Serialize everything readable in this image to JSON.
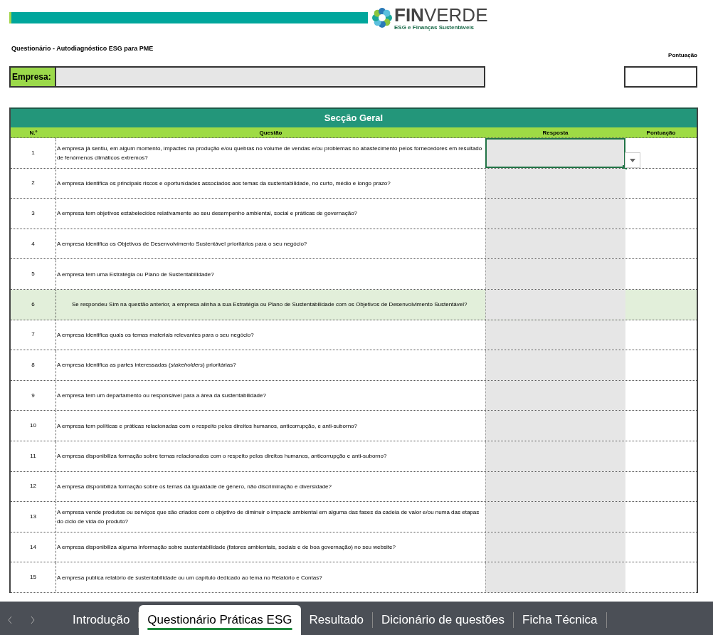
{
  "logo": {
    "name": "**FIN**VERDE",
    "tagline": "ESG e Finanças Sustentáveis"
  },
  "title": "Questionário - Autodiagnóstico ESG para PME",
  "score_label": "Pontuação",
  "company": {
    "label": "Empresa:"
  },
  "section": {
    "title": "Secção Geral",
    "columns": [
      "N.º",
      "Questão",
      "Resposta",
      "Pontuação"
    ],
    "rows": [
      {
        "number": "1",
        "question": "A empresa já sentiu, em algum momento, impactes na produção e/ou quebras no volume de vendas e/ou problemas no abastecimento pelos fornecedores em resultado de fenómenos climáticos extremos?",
        "kind": "main",
        "selected": true
      },
      {
        "number": "2",
        "question": "A empresa identifica os principais riscos e oportunidades associados aos temas da sustentabilidade, no curto, médio e longo prazo?",
        "kind": "main",
        "selected": false
      },
      {
        "number": "3",
        "question": "A empresa tem objetivos estabelecidos relativamente ao seu desempenho ambiental, social e práticas de governação?",
        "kind": "main",
        "selected": false
      },
      {
        "number": "4",
        "question": "A empresa identifica os Objetivos de Desenvolvimento Sustentável prioritários para o seu negócio?",
        "kind": "main",
        "selected": false
      },
      {
        "number": "5",
        "question": "A empresa tem uma Estratégia ou Plano de Sustentabilidade?",
        "kind": "main",
        "selected": false
      },
      {
        "number": "6",
        "question": "Se respondeu Sim na questão anterior, a empresa alinha a sua Estratégia ou Plano de Sustentabilidade com os Objetivos de Desenvolvimento Sustentável?",
        "kind": "conditional",
        "selected": false
      },
      {
        "number": "7",
        "question": "A empresa identifica quais os temas materiais relevantes para o seu negócio?",
        "kind": "main",
        "selected": false
      },
      {
        "number": "8",
        "question": "A empresa identifica as partes interessadas (*stakeholders*) prioritárias?",
        "kind": "main",
        "selected": false
      },
      {
        "number": "9",
        "question": "A empresa tem um departamento ou responsável para a área da sustentabilidade?",
        "kind": "main",
        "selected": false
      },
      {
        "number": "10",
        "question": "A empresa tem políticas e práticas relacionadas com o respeito pelos direitos humanos, anticorrupção, e anti-suborno?",
        "kind": "main",
        "selected": false
      },
      {
        "number": "11",
        "question": "A empresa disponibiliza formação sobre temas relacionados com o respeito pelos direitos humanos, anticorrupção e anti-suborno?",
        "kind": "main",
        "selected": false
      },
      {
        "number": "12",
        "question": "A empresa disponibiliza formação sobre os temas da igualdade de género, não discriminação e diversidade?",
        "kind": "main",
        "selected": false
      },
      {
        "number": "13",
        "question": "A empresa vende produtos ou serviços que são criados com o objetivo de diminuir o impacte ambiental em alguma das fases da cadeia de valor e/ou numa das etapas do ciclo de vida do produto?",
        "kind": "main",
        "selected": false
      },
      {
        "number": "14",
        "question": "A empresa disponibiliza alguma informação sobre sustentabilidade (fatores ambientais, sociais e de boa governação) no seu website?",
        "kind": "main",
        "selected": false
      },
      {
        "number": "15",
        "question": "A empresa publica relatório de sustentabilidade ou um capítulo dedicado ao tema no Relatório e Contas?",
        "kind": "main",
        "selected": false
      }
    ]
  },
  "sheet_tabs": [
    {
      "label": "Introdução",
      "selected": false
    },
    {
      "label": "Questionário Práticas ESG",
      "selected": true
    },
    {
      "label": "Resultado",
      "selected": false
    },
    {
      "label": "Dicionário de questões",
      "selected": false
    },
    {
      "label": "Ficha Técnica",
      "selected": false
    }
  ]
}
